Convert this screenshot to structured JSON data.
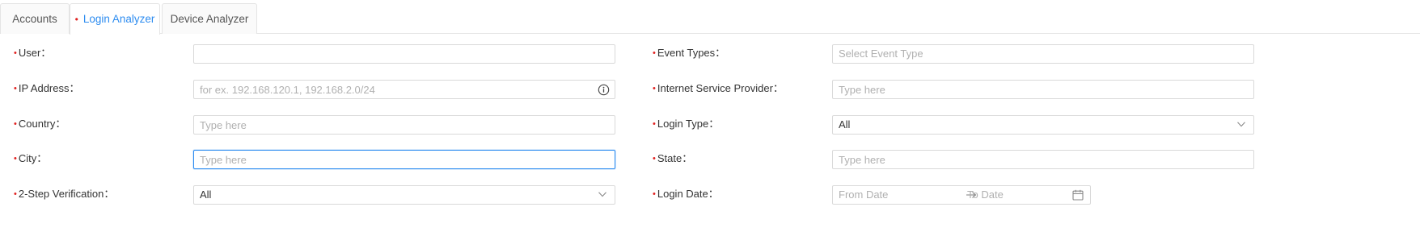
{
  "tabs": [
    {
      "label": "Accounts",
      "active": false,
      "required": false
    },
    {
      "label": "Login Analyzer",
      "active": true,
      "required": true
    },
    {
      "label": "Device Analyzer",
      "active": false,
      "required": false
    }
  ],
  "required_marker": "•",
  "form": {
    "user": {
      "label": "User：",
      "value": "",
      "placeholder": ""
    },
    "ip_address": {
      "label": "IP Address：",
      "value": "",
      "placeholder": "for ex. 192.168.120.1, 192.168.2.0/24",
      "icon": "info-circle-icon"
    },
    "country": {
      "label": "Country：",
      "value": "",
      "placeholder": "Type here"
    },
    "city": {
      "label": "City：",
      "value": "",
      "placeholder": "Type here",
      "focused": true
    },
    "two_step": {
      "label": "2-Step Verification：",
      "selected": "All",
      "icon": "chevron-down-icon"
    },
    "event_types": {
      "label": "Event Types：",
      "placeholder": "Select Event Type"
    },
    "isp": {
      "label": "Internet Service Provider：",
      "value": "",
      "placeholder": "Type here"
    },
    "login_type": {
      "label": "Login Type：",
      "selected": "All",
      "icon": "chevron-down-icon"
    },
    "state": {
      "label": "State：",
      "value": "",
      "placeholder": "Type here"
    },
    "login_date": {
      "label": "Login Date：",
      "from_placeholder": "From Date",
      "to_placeholder": "To Date",
      "separator_icon": "arrow-right-icon",
      "icon": "calendar-icon"
    }
  },
  "colors": {
    "accent": "#2d8cf0",
    "required": "#e0201f",
    "border": "#d9d9d9",
    "placeholder": "#b0b0b0"
  }
}
